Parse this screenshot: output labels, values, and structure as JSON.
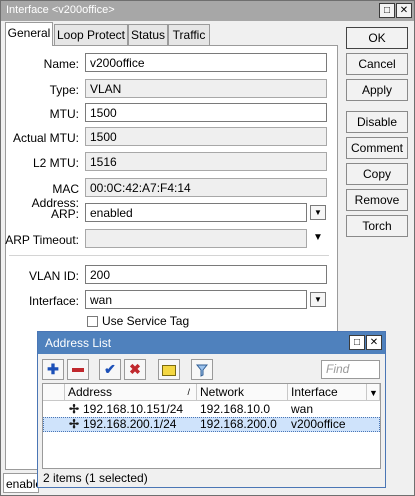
{
  "window": {
    "title": "Interface <v200office>",
    "max_icon": "□",
    "close_icon": "✕"
  },
  "tabs": [
    "General",
    "Loop Protect",
    "Status",
    "Traffic"
  ],
  "form": {
    "name": {
      "label": "Name:",
      "value": "v200office"
    },
    "type": {
      "label": "Type:",
      "value": "VLAN"
    },
    "mtu": {
      "label": "MTU:",
      "value": "1500"
    },
    "actual_mtu": {
      "label": "Actual MTU:",
      "value": "1500"
    },
    "l2_mtu": {
      "label": "L2 MTU:",
      "value": "1516"
    },
    "mac": {
      "label": "MAC Address:",
      "value": "00:0C:42:A7:F4:14"
    },
    "arp": {
      "label": "ARP:",
      "value": "enabled"
    },
    "arp_timeout": {
      "label": "ARP Timeout:",
      "value": ""
    },
    "vlan_id": {
      "label": "VLAN ID:",
      "value": "200"
    },
    "interface": {
      "label": "Interface:",
      "value": "wan"
    },
    "use_service_tag": {
      "label": "Use Service Tag",
      "checked": false
    }
  },
  "buttons": [
    "OK",
    "Cancel",
    "Apply",
    "Disable",
    "Comment",
    "Copy",
    "Remove",
    "Torch"
  ],
  "address_list": {
    "title": "Address List",
    "find_placeholder": "Find",
    "columns": [
      "Address",
      "Network",
      "Interface"
    ],
    "sort_marker": "/",
    "rows": [
      {
        "address": "192.168.10.151/24",
        "network": "192.168.10.0",
        "interface": "wan",
        "selected": false
      },
      {
        "address": "192.168.200.1/24",
        "network": "192.168.200.0",
        "interface": "v200office",
        "selected": true
      }
    ],
    "status": "2 items (1 selected)",
    "toolbar_icons": [
      "add-icon",
      "remove-icon",
      "enable-icon",
      "disable-icon",
      "comment-icon",
      "filter-icon"
    ]
  },
  "bottom_status": "enabled",
  "colors": {
    "title_inactive": "#a7a7a7",
    "title_active": "#4f81bd",
    "selection": "#cfe3fb"
  }
}
